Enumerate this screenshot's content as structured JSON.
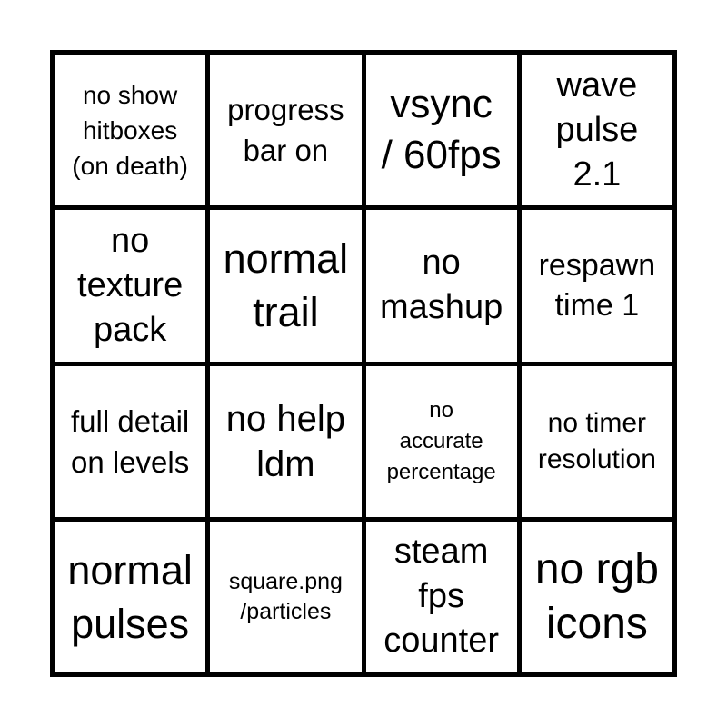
{
  "board": {
    "cells": [
      {
        "lines": [
          "no show",
          "hitboxes",
          "(on death)"
        ]
      },
      {
        "lines": [
          "progress",
          "bar on"
        ]
      },
      {
        "lines": [
          "vsync",
          "/ 60fps"
        ]
      },
      {
        "lines": [
          "wave",
          "pulse",
          "2.1"
        ]
      },
      {
        "lines": [
          "no",
          "texture",
          "pack"
        ]
      },
      {
        "lines": [
          "normal",
          "trail"
        ]
      },
      {
        "lines": [
          "no",
          "mashup"
        ]
      },
      {
        "lines": [
          "respawn",
          "time 1"
        ]
      },
      {
        "lines": [
          "full detail",
          "on levels"
        ]
      },
      {
        "lines": [
          "no help",
          "ldm"
        ]
      },
      {
        "lines": [
          "no",
          "accurate",
          "percentage"
        ]
      },
      {
        "lines": [
          "no timer",
          "resolution"
        ]
      },
      {
        "lines": [
          "normal",
          "pulses"
        ]
      },
      {
        "lines": [
          "square.png",
          "/particles"
        ]
      },
      {
        "lines": [
          "steam",
          "fps",
          "counter"
        ]
      },
      {
        "lines": [
          "no rgb",
          "icons"
        ]
      }
    ]
  }
}
